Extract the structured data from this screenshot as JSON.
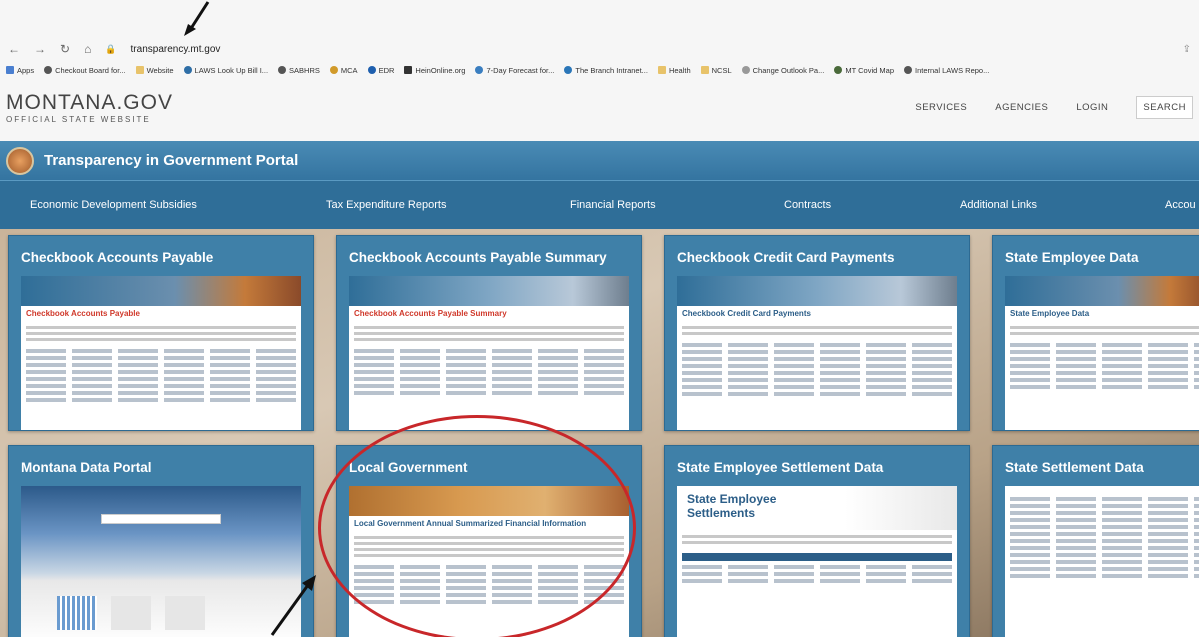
{
  "browser": {
    "url": "transparency.mt.gov",
    "bookmarks": [
      "Apps",
      "Checkout Board for...",
      "Website",
      "LAWS Look Up Bill I...",
      "SABHRS",
      "MCA",
      "EDR",
      "HeinOnline.org",
      "7-Day Forecast for...",
      "The Branch Intranet...",
      "Health",
      "NCSL",
      "Change Outlook Pa...",
      "MT Covid Map",
      "Internal LAWS Repo..."
    ]
  },
  "site": {
    "logo_main": "MONTANA.GOV",
    "logo_sub": "OFFICIAL STATE WEBSITE",
    "nav": [
      "SERVICES",
      "AGENCIES",
      "LOGIN",
      "SEARCH"
    ]
  },
  "portal": {
    "title": "Transparency in Government Portal",
    "menu": [
      "Economic Development Subsidies",
      "Tax Expenditure Reports",
      "Financial Reports",
      "Contracts",
      "Additional Links",
      "Accou"
    ]
  },
  "cards": [
    {
      "title": "Checkbook Accounts Payable",
      "thumb_title": "Checkbook Accounts Payable"
    },
    {
      "title": "Checkbook Accounts Payable Summary",
      "thumb_title": "Checkbook Accounts Payable Summary"
    },
    {
      "title": "Checkbook Credit Card Payments",
      "thumb_title": "Checkbook Credit Card Payments"
    },
    {
      "title": "State Employee Data",
      "thumb_title": "State Employee Data"
    },
    {
      "title": "Montana Data Portal",
      "thumb_title": ""
    },
    {
      "title": "Local Government",
      "thumb_title": "Local Government Annual Summarized Financial Information"
    },
    {
      "title": "State Employee Settlement Data",
      "thumb_title": "State Employee Settlements"
    },
    {
      "title": "State Settlement Data",
      "thumb_title": ""
    }
  ],
  "colors": {
    "accent": "#3f80a8",
    "highlight": "#c8272a"
  }
}
